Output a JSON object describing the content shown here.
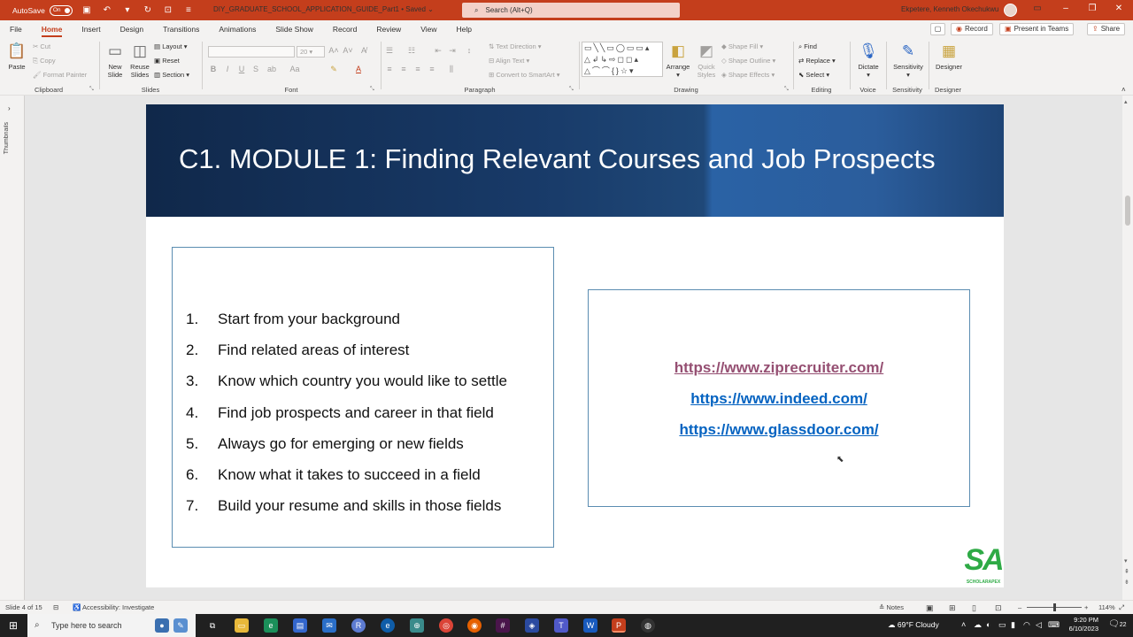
{
  "titlebar": {
    "autosave_label": "AutoSave",
    "autosave_state": "On",
    "document_title": "DIY_GRADUATE_SCHOOL_APPLICATION_GUIDE_Part1 • Saved",
    "search_placeholder": "Search (Alt+Q)",
    "user_name": "Ekpetere, Kenneth Okechukwu"
  },
  "tabs": [
    "File",
    "Home",
    "Insert",
    "Design",
    "Transitions",
    "Animations",
    "Slide Show",
    "Record",
    "Review",
    "View",
    "Help"
  ],
  "active_tab": "Home",
  "top_buttons": {
    "record": "Record",
    "present": "Present in Teams",
    "share": "Share"
  },
  "ribbon": {
    "clipboard": {
      "label": "Clipboard",
      "paste": "Paste",
      "cut": "Cut",
      "copy": "Copy",
      "format_painter": "Format Painter"
    },
    "slides": {
      "label": "Slides",
      "new_slide": "New Slide",
      "reuse_slides": "Reuse Slides",
      "layout": "Layout",
      "reset": "Reset",
      "section": "Section"
    },
    "font": {
      "label": "Font",
      "font_size": "20",
      "bold": "B",
      "italic": "I",
      "underline": "U",
      "strike": "S"
    },
    "paragraph": {
      "label": "Paragraph",
      "text_direction": "Text Direction",
      "align_text": "Align Text",
      "convert_smartart": "Convert to SmartArt"
    },
    "drawing": {
      "label": "Drawing",
      "arrange": "Arrange",
      "quick_styles": "Quick Styles",
      "shape_fill": "Shape Fill",
      "shape_outline": "Shape Outline",
      "shape_effects": "Shape Effects"
    },
    "editing": {
      "label": "Editing",
      "find": "Find",
      "replace": "Replace",
      "select": "Select"
    },
    "voice": {
      "label": "Voice",
      "dictate": "Dictate"
    },
    "sensitivity": {
      "label": "Sensitivity",
      "button": "Sensitivity"
    },
    "designer": {
      "label": "Designer",
      "button": "Designer"
    }
  },
  "thumbnails_label": "Thumbnails",
  "slide": {
    "title": "C1. MODULE 1: Finding Relevant Courses and Job Prospects",
    "steps": [
      {
        "num": "1.",
        "text": "Start from your background"
      },
      {
        "num": "2.",
        "text": "Find related areas of interest"
      },
      {
        "num": "3.",
        "text": "Know which country you would like to settle"
      },
      {
        "num": "4.",
        "text": "Find job prospects and career in that field"
      },
      {
        "num": "5.",
        "text": "Always go for emerging or new fields"
      },
      {
        "num": "6.",
        "text": "Know what it takes to succeed in a field"
      },
      {
        "num": "7.",
        "text": "Build your resume and skills in those fields"
      }
    ],
    "links": [
      {
        "text": "https://www.ziprecruiter.com/",
        "color": "#954f72"
      },
      {
        "text": "https://www.indeed.com/",
        "color": "#0563c1"
      },
      {
        "text": "https://www.glassdoor.com/",
        "color": "#0563c1"
      }
    ],
    "logo_text": "SA",
    "logo_sub": "SCHOLARAPEX"
  },
  "statusbar": {
    "slide_info": "Slide 4 of 15",
    "accessibility": "Accessibility: Investigate",
    "notes": "Notes",
    "zoom": "114%"
  },
  "taskbar": {
    "search_placeholder": "Type here to search",
    "weather": "69°F  Cloudy",
    "time": "9:20 PM",
    "date": "6/10/2023",
    "notification_count": "22"
  },
  "colors": {
    "accent": "#c43e1c",
    "link_visited": "#954f72",
    "link": "#0563c1",
    "logo_green": "#2eaa45"
  }
}
